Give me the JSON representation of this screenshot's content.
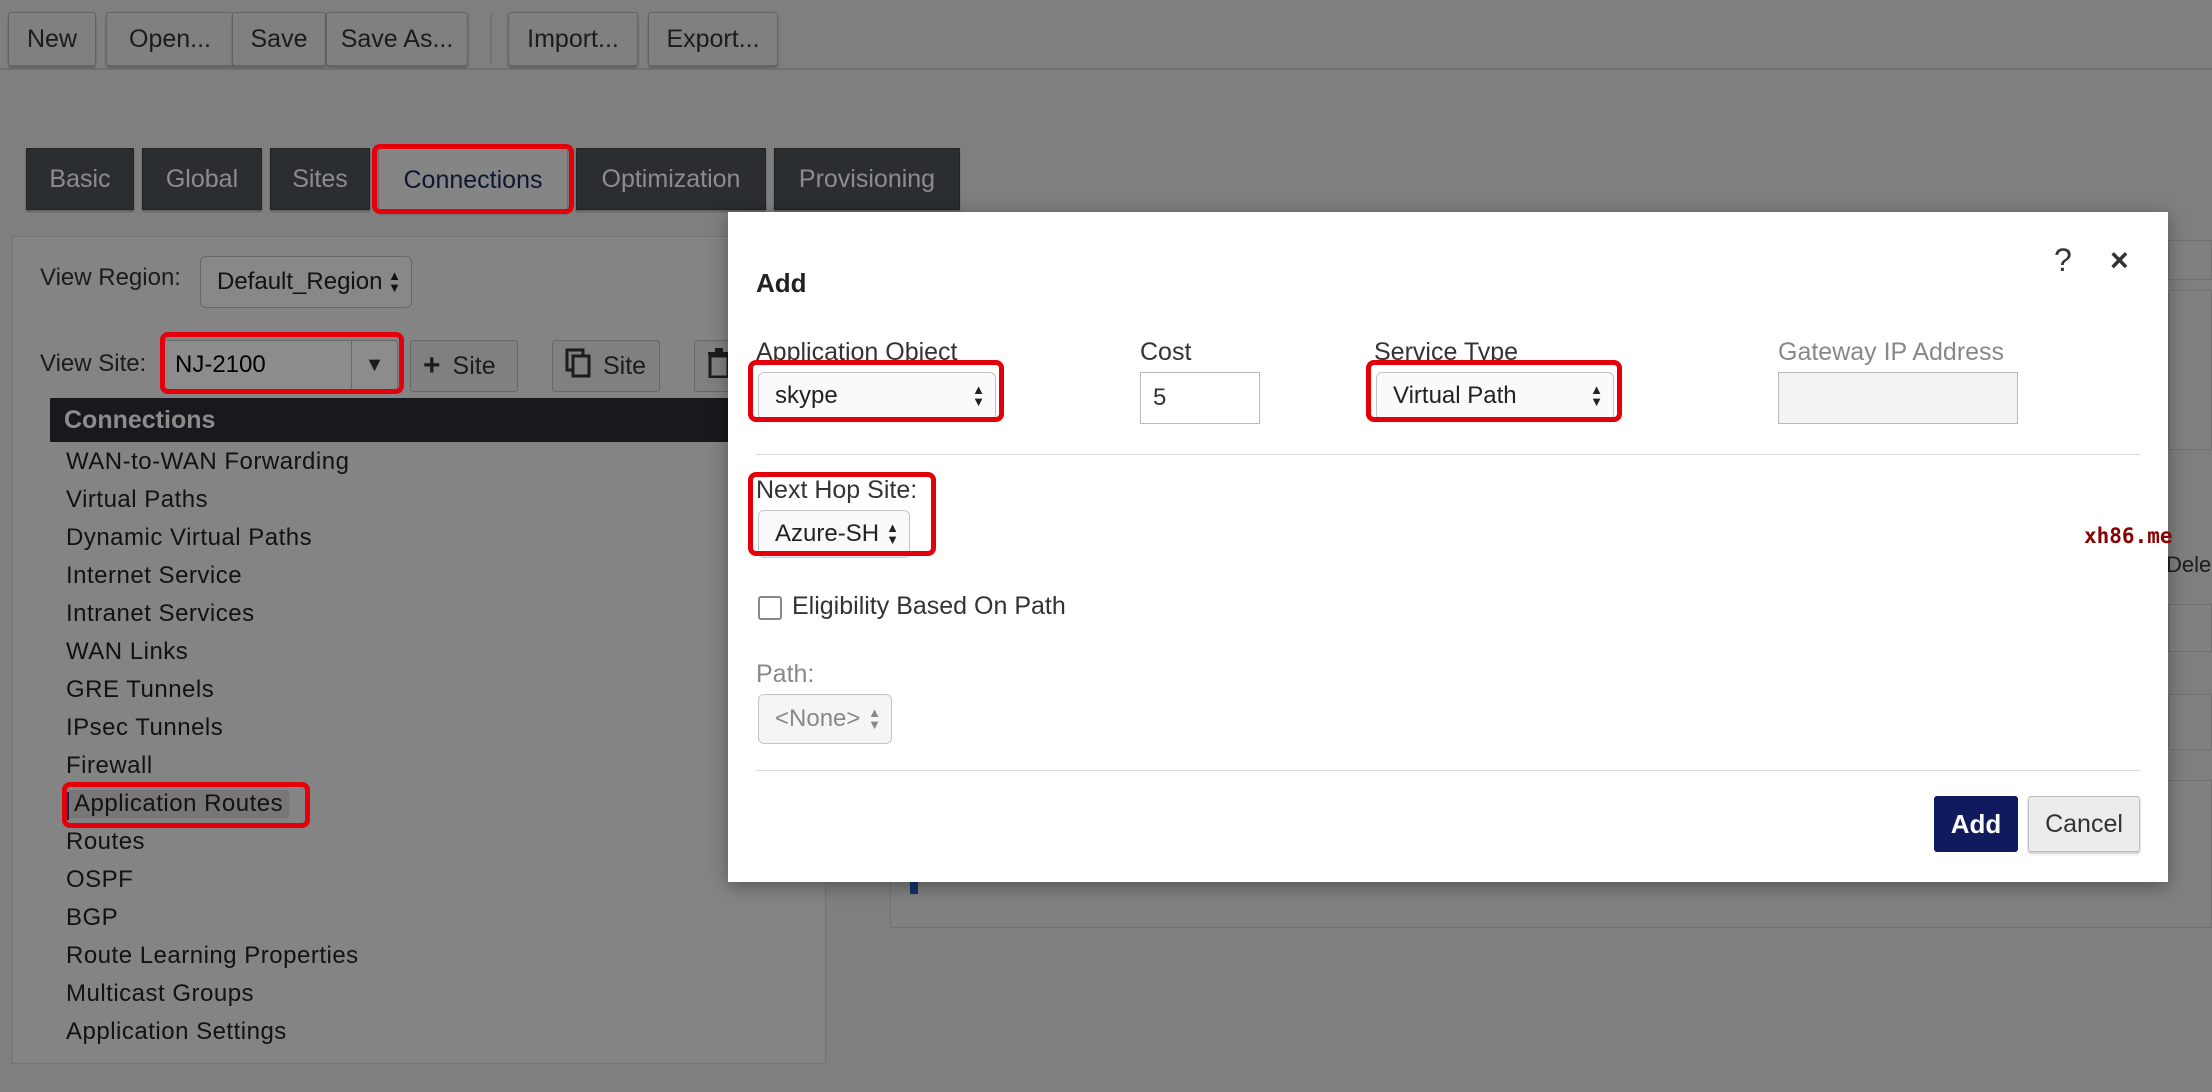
{
  "toolbar": {
    "buttons": [
      "New",
      "Open...",
      "Save",
      "Save As...",
      "Import...",
      "Export..."
    ]
  },
  "tabs": [
    "Basic",
    "Global",
    "Sites",
    "Connections",
    "Optimization",
    "Provisioning"
  ],
  "active_tab": "Connections",
  "panel": {
    "view_region_label": "View Region:",
    "view_region_value": "Default_Region",
    "view_site_label": "View Site:",
    "view_site_value": "NJ-2100",
    "add_site_label": "Site",
    "copy_site_label": "Site",
    "connections_header": "Connections",
    "nav_items": [
      "WAN-to-WAN Forwarding",
      "Virtual Paths",
      "Dynamic Virtual Paths",
      "Internet Service",
      "Intranet Services",
      "WAN Links",
      "GRE Tunnels",
      "IPsec Tunnels",
      "Firewall",
      "Application Routes",
      "Routes",
      "OSPF",
      "BGP",
      "Route Learning Properties",
      "Multicast Groups",
      "Application Settings"
    ],
    "selected_nav": "Application Routes"
  },
  "background": {
    "partial_delete_text": "Dele"
  },
  "modal": {
    "title": "Add",
    "help_icon": "?",
    "close_icon": "×",
    "application_object_label": "Application Object",
    "application_object_value": "skype",
    "cost_label": "Cost",
    "cost_value": "5",
    "service_type_label": "Service Type",
    "service_type_value": "Virtual Path",
    "gateway_ip_label": "Gateway IP Address",
    "gateway_ip_value": "",
    "next_hop_label": "Next Hop Site:",
    "next_hop_value": "Azure-SH",
    "eligibility_label": "Eligibility Based On Path",
    "eligibility_checked": false,
    "path_label": "Path:",
    "path_value": "<None>",
    "add_button": "Add",
    "cancel_button": "Cancel"
  },
  "watermark": "xh86.me",
  "colors": {
    "highlight": "#e3000b",
    "primary_button": "#101b5e",
    "tab_dark": "#4e545a",
    "header_dark": "#2b2f33"
  }
}
